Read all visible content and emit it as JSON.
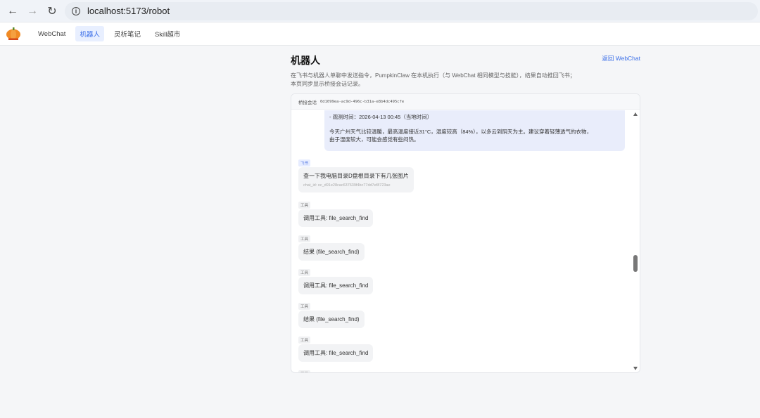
{
  "browser": {
    "url": "localhost:5173/robot"
  },
  "nav": {
    "items": [
      {
        "label": "WebChat",
        "active": false
      },
      {
        "label": "机器人",
        "active": true
      },
      {
        "label": "灵析笔记",
        "active": false
      },
      {
        "label": "Skill超市",
        "active": false
      }
    ]
  },
  "page": {
    "title": "机器人",
    "back_link": "返回 WebChat",
    "desc_line1": "在飞书与机器人单聊中发送指令，PumpkinClaw 在本机执行（与 WebChat 相同模型与技能），结果自动推回飞书；",
    "desc_line2": "本页同步显示桥接会话记录。"
  },
  "session": {
    "label": "桥接会话",
    "id": "0d1099ea-ac9d-496c-b31a-e8b4dc495cfe"
  },
  "messages": {
    "bot": {
      "line1": "- 观测时间：2026-04-13 00:45（当地时间）",
      "line2": "今天广州天气比较温暖，最高温度接近31°C，湿度较高（84%），以多云到阴天为主。建议穿着轻薄透气的衣物，",
      "line3": "由于湿度较大，可能会感觉有些闷热。"
    },
    "feishu_tag": "飞书",
    "feishu_text": "查一下我电脑目录D盘根目录下有几张图片",
    "feishu_chat_id": "chat_id: oc_d91e28cac637639f4bc77dd7ef8723ae",
    "tool_tag": "工具",
    "tools": [
      {
        "text": "调用工具: file_search_find"
      },
      {
        "text": "结果 (file_search_find)"
      },
      {
        "text": "调用工具: file_search_find"
      },
      {
        "text": "结果 (file_search_find)"
      },
      {
        "text": "调用工具: file_search_find"
      }
    ]
  },
  "colors": {
    "accent": "#3a6ee8",
    "bot_bubble": "#e9edfb",
    "user_bubble": "#f2f3f5"
  }
}
